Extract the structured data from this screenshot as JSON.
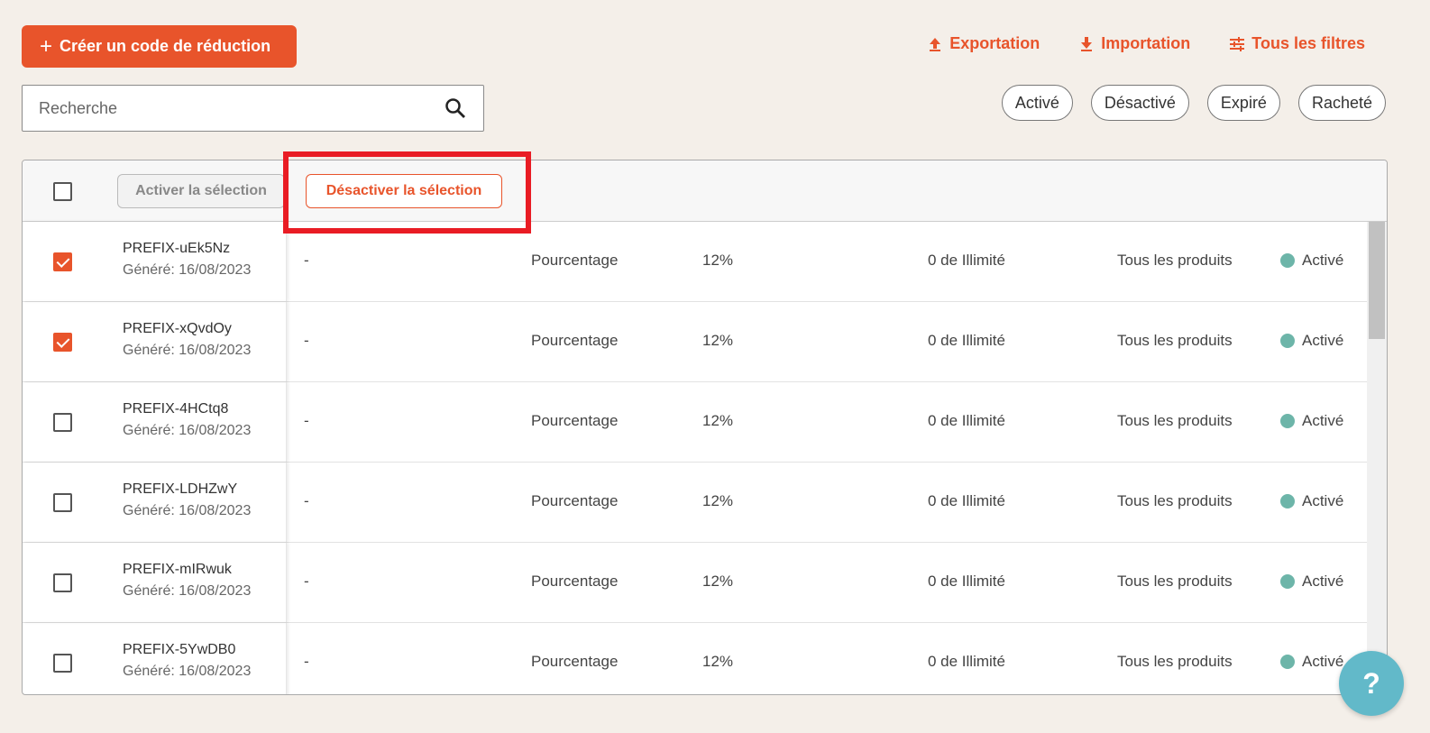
{
  "toolbar": {
    "create_label": "Créer un code de réduction",
    "export_label": "Exportation",
    "import_label": "Importation",
    "filters_label": "Tous les filtres"
  },
  "search": {
    "placeholder": "Recherche"
  },
  "status_chips": [
    "Activé",
    "Désactivé",
    "Expiré",
    "Racheté"
  ],
  "bulk_actions": {
    "activate_label": "Activer la sélection",
    "deactivate_label": "Désactiver la sélection"
  },
  "rows": [
    {
      "code": "PREFIX-uEk5Nz",
      "generated": "Généré: 16/08/2023",
      "description": "-",
      "type": "Pourcentage",
      "value": "12%",
      "usage": "0 de Illimité",
      "products": "Tous les produits",
      "status": "Activé",
      "checked": true
    },
    {
      "code": "PREFIX-xQvdOy",
      "generated": "Généré: 16/08/2023",
      "description": "-",
      "type": "Pourcentage",
      "value": "12%",
      "usage": "0 de Illimité",
      "products": "Tous les produits",
      "status": "Activé",
      "checked": true
    },
    {
      "code": "PREFIX-4HCtq8",
      "generated": "Généré: 16/08/2023",
      "description": "-",
      "type": "Pourcentage",
      "value": "12%",
      "usage": "0 de Illimité",
      "products": "Tous les produits",
      "status": "Activé",
      "checked": false
    },
    {
      "code": "PREFIX-LDHZwY",
      "generated": "Généré: 16/08/2023",
      "description": "-",
      "type": "Pourcentage",
      "value": "12%",
      "usage": "0 de Illimité",
      "products": "Tous les produits",
      "status": "Activé",
      "checked": false
    },
    {
      "code": "PREFIX-mIRwuk",
      "generated": "Généré: 16/08/2023",
      "description": "-",
      "type": "Pourcentage",
      "value": "12%",
      "usage": "0 de Illimité",
      "products": "Tous les produits",
      "status": "Activé",
      "checked": false
    },
    {
      "code": "PREFIX-5YwDB0",
      "generated": "Généré: 16/08/2023",
      "description": "-",
      "type": "Pourcentage",
      "value": "12%",
      "usage": "0 de Illimité",
      "products": "Tous les produits",
      "status": "Activé",
      "checked": false
    }
  ],
  "help": {
    "label": "?"
  },
  "colors": {
    "accent": "#e8542b",
    "status_active": "#6db5a9",
    "highlight": "#e91c24",
    "help": "#62b9c9"
  }
}
